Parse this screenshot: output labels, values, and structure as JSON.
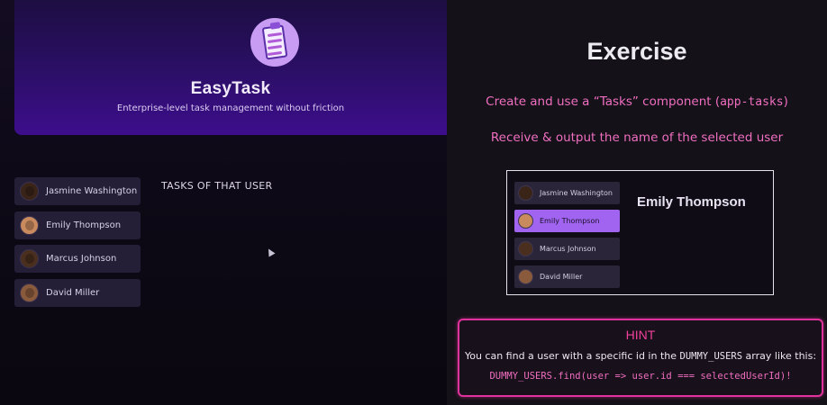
{
  "app": {
    "title": "EasyTask",
    "subtitle": "Enterprise-level task management without friction",
    "logo_icon": "clipboard-checklist-icon",
    "tasks_heading": "TASKS OF THAT USER",
    "users": [
      {
        "name": "Jasmine Washington",
        "avatar_color": "#3a2418"
      },
      {
        "name": "Emily Thompson",
        "avatar_color": "#c98a5e"
      },
      {
        "name": "Marcus Johnson",
        "avatar_color": "#4a2e1e"
      },
      {
        "name": "David Miller",
        "avatar_color": "#8a5a3c"
      }
    ]
  },
  "slide": {
    "title": "Exercise",
    "line1_prefix": "Create and use a “Tasks” component (",
    "line1_code": "app-tasks",
    "line1_suffix": ")",
    "line2": "Receive & output the name of the selected user",
    "preview": {
      "users": [
        {
          "name": "Jasmine Washington",
          "selected": false,
          "avatar_color": "#3a2418"
        },
        {
          "name": "Emily Thompson",
          "selected": true,
          "avatar_color": "#c98a5e"
        },
        {
          "name": "Marcus Johnson",
          "selected": false,
          "avatar_color": "#4a2e1e"
        },
        {
          "name": "David Miller",
          "selected": false,
          "avatar_color": "#8a5a3c"
        }
      ],
      "selected_name": "Emily Thompson"
    },
    "hint": {
      "title": "HINT",
      "text_prefix": "You can find a user with a specific id in the ",
      "text_code": "DUMMY_USERS",
      "text_suffix": " array like this:",
      "code": "DUMMY_USERS.find(user => user.id === selectedUserId)!"
    }
  },
  "colors": {
    "accent_pink": "#f06ec0",
    "hint_border": "#e0329c",
    "header_purple": "#3d0e8c",
    "selected_user": "#a064f0"
  }
}
